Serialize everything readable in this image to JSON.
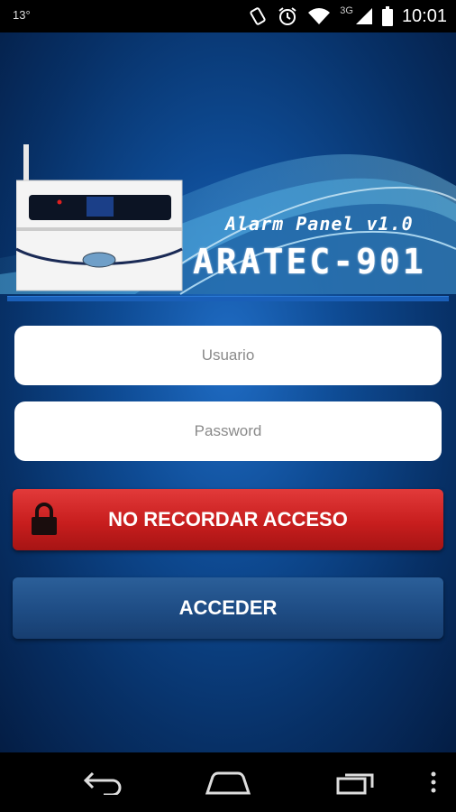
{
  "status_bar": {
    "temperature": "13°",
    "network": "3G",
    "time": "10:01",
    "icons": [
      "rotation-icon",
      "alarm-icon",
      "wifi-icon",
      "signal-icon",
      "battery-icon"
    ]
  },
  "header": {
    "subtitle": "Alarm Panel v1.0",
    "model": "ARATEC-901"
  },
  "form": {
    "username_placeholder": "Usuario",
    "username_value": "",
    "password_placeholder": "Password",
    "password_value": ""
  },
  "buttons": {
    "remember_label": "NO RECORDAR ACCESO",
    "access_label": "ACCEDER"
  },
  "colors": {
    "remember_button": "#c81e1e",
    "access_button": "#1e4c84",
    "background": "#0e4b94"
  },
  "nav": {
    "icons": [
      "back-icon",
      "home-icon",
      "recent-apps-icon",
      "overflow-menu-icon"
    ]
  }
}
